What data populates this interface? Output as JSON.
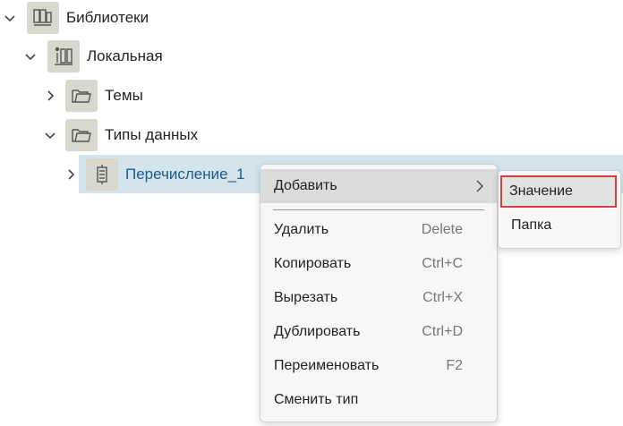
{
  "tree": {
    "libraries": "Библиотеки",
    "local": "Локальная",
    "themes": "Темы",
    "data_types": "Типы данных",
    "enum": "Перечисление_1"
  },
  "context_menu": {
    "add": "Добавить",
    "delete": "Удалить",
    "delete_shortcut": "Delete",
    "copy": "Копировать",
    "copy_shortcut": "Ctrl+C",
    "cut": "Вырезать",
    "cut_shortcut": "Ctrl+X",
    "duplicate": "Дублировать",
    "duplicate_shortcut": "Ctrl+D",
    "rename": "Переименовать",
    "rename_shortcut": "F2",
    "change_type": "Сменить тип"
  },
  "submenu": {
    "value": "Значение",
    "folder": "Папка"
  },
  "colors": {
    "selection": "#d3e4ed",
    "selected_text": "#1e5a8a",
    "highlight_border": "#e0383e"
  },
  "icons": {
    "libraries": "library-books-icon",
    "local": "local-library-icon",
    "folder": "folder-icon",
    "enum": "enumeration-icon"
  }
}
